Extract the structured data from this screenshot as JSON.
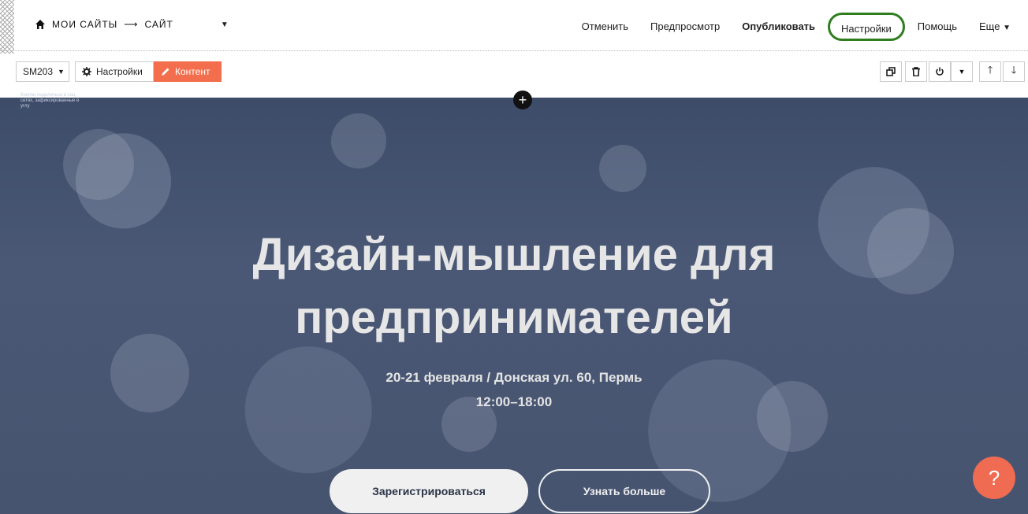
{
  "breadcrumb": {
    "part1": "МОИ САЙТЫ",
    "arrow": "⟶",
    "part2": "САЙТ"
  },
  "nav": {
    "cancel": "Отменить",
    "preview": "Предпросмотр",
    "publish": "Опубликовать",
    "settings": "Настройки",
    "help": "Помощь",
    "more": "Еще"
  },
  "toolbar": {
    "block_id": "SM203",
    "settings_label": "Настройки",
    "content_label": "Контент"
  },
  "hint_text": "Кнопки поделиться в соц. сетях, зафиксированные в углу",
  "hero": {
    "title_line1": "Дизайн-мышление для",
    "title_line2": "предпринимателей",
    "date_place": "20-21 февраля / Донская ул. 60, Пермь",
    "time": "12:00–18:00",
    "register_button": "Зарегистрироваться",
    "learn_more_button": "Узнать больше"
  },
  "colors": {
    "accent": "#f36e4d",
    "highlight_ring": "#2e7d1f",
    "hero_overlay": "#46546f"
  },
  "icons": [
    "home-icon",
    "chevron-down-icon",
    "gear-icon",
    "pencil-icon",
    "duplicate-icon",
    "trash-icon",
    "power-icon",
    "arrow-up-icon",
    "arrow-down-icon",
    "plus-icon",
    "help-icon"
  ]
}
